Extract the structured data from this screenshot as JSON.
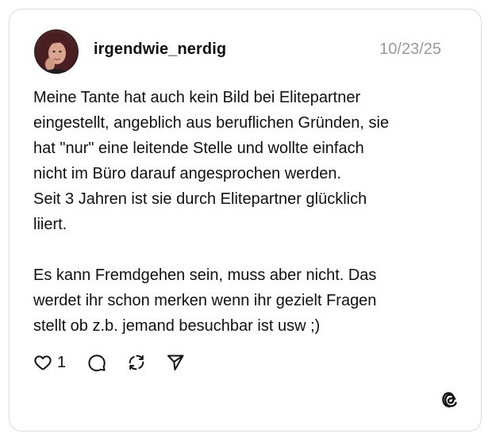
{
  "post": {
    "username": "irgendwie_nerdig",
    "timestamp": "10/23/25",
    "paragraphs": [
      "Meine Tante hat auch kein Bild bei Elitepartner\neingestellt, angeblich aus beruflichen Gründen, sie\nhat \"nur\" eine leitende Stelle und wollte einfach\nnicht im Büro darauf angesprochen werden.\nSeit 3 Jahren ist sie durch Elitepartner glücklich\nliiert.",
      "Es kann Fremdgehen sein, muss aber nicht. Das\nwerdet ihr schon merken wenn ihr gezielt Fragen\nstellt ob z.b. jemand besuchbar ist usw ;)"
    ],
    "like_count": "1"
  },
  "icons": {
    "like": "heart-icon",
    "comment": "comment-bubble-icon",
    "repost": "repost-icon",
    "share": "send-icon",
    "brand": "threads-logo-icon"
  }
}
